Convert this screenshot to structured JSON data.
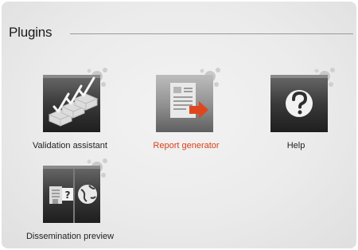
{
  "section": {
    "title": "Plugins"
  },
  "plugins": [
    {
      "label": "Validation assistant",
      "icon": "validation-checkmarks-icon",
      "active": false
    },
    {
      "label": "Report generator",
      "icon": "report-document-arrow-icon",
      "active": true
    },
    {
      "label": "Help",
      "icon": "help-question-icon",
      "active": false
    },
    {
      "label": "Dissemination preview",
      "icon": "dissemination-globe-icon",
      "active": false
    }
  ],
  "colors": {
    "active_label": "#d9401c",
    "arrow_accent": "#e0461e",
    "tile_dark": "#2e2e2e"
  }
}
